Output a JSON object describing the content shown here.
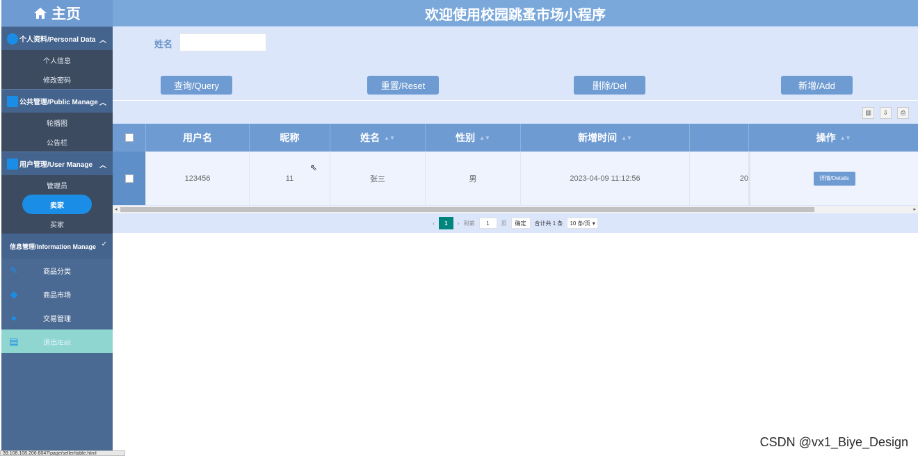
{
  "sidebar": {
    "home_label": "主页",
    "groups": [
      {
        "label": "个人资料/Personal Data",
        "items": [
          "个人信息",
          "修改密码"
        ]
      },
      {
        "label": "公共管理/Public Manage",
        "items": [
          "轮播图",
          "公告栏"
        ]
      },
      {
        "label": "用户管理/User Manage",
        "items": [
          "管理员",
          "卖家",
          "买家"
        ],
        "active": "卖家"
      }
    ],
    "info_group_label": "信息管理/Information Manage",
    "nav": [
      {
        "label": "商品分类",
        "icon": "pencil-icon"
      },
      {
        "label": "商品市场",
        "icon": "tag-icon"
      },
      {
        "label": "交易管理",
        "icon": "globe-icon"
      }
    ],
    "exit_label": "退出/Exit"
  },
  "header": {
    "title": "欢迎使用校园跳蚤市场小程序"
  },
  "search": {
    "name_label": "姓名",
    "name_value": ""
  },
  "buttons": {
    "query": "查询/Query",
    "reset": "重置/Reset",
    "delete": "删除/Del",
    "add": "新增/Add"
  },
  "table": {
    "columns": [
      "用户名",
      "昵称",
      "姓名",
      "性别",
      "新增时间",
      "操作"
    ],
    "rows": [
      {
        "username": "123456",
        "nickname": "11",
        "name": "张三",
        "gender": "男",
        "created": "2023-04-09 11:12:56",
        "overflow": "20",
        "action": "详情/Details"
      }
    ]
  },
  "pager": {
    "current": "1",
    "goto_label": "到第",
    "goto_value": "1",
    "page_unit": "页",
    "confirm": "确定",
    "total": "合计共 1 条",
    "page_size": "10 条/页"
  },
  "status_url": "39.108.108.206:8047/page/seller/table.html",
  "watermark": "CSDN @vx1_Biye_Design",
  "colors": {
    "accent": "#6f9bd3",
    "sidebar": "#4b6a93",
    "active": "#1a8ee6",
    "page_current": "#00857d"
  }
}
